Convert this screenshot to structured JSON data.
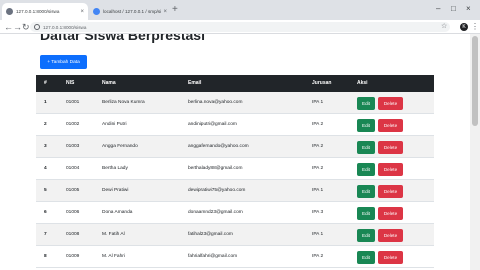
{
  "browser": {
    "tabs": [
      {
        "title": "127.0.0.1:8000/siswa",
        "close": "×"
      },
      {
        "title": "localhost / 127.0.0.1 / smp/siswa",
        "close": "×"
      }
    ],
    "new_tab": "+",
    "window_controls": {
      "minimize": "–",
      "maximize": "□",
      "close": "×"
    },
    "nav": {
      "back": "←",
      "forward": "→",
      "reload": "↻"
    },
    "url": "127.0.0.1:8000/siswa",
    "profile_initial": "K"
  },
  "page": {
    "title": "Daftar Siswa Berprestasi",
    "add_button": "+ Tambah Data"
  },
  "table": {
    "headers": {
      "no": "#",
      "nis": "NIS",
      "nama": "Nama",
      "email": "Email",
      "jurusan": "Jurusan",
      "aksi": "Aksi"
    },
    "edit_label": "Edit",
    "delete_label": "Delete",
    "rows": [
      {
        "no": "1",
        "nis": "01001",
        "nama": "Berliza Nova Kumra",
        "email": "berlina.nova@yahoo.com",
        "jurusan": "IPA 1"
      },
      {
        "no": "2",
        "nis": "01002",
        "nama": "Andini Putri",
        "email": "andiniputri@gmail.com",
        "jurusan": "IPA 2"
      },
      {
        "no": "3",
        "nis": "01003",
        "nama": "Angga Fernando",
        "email": "anggafernando@yahoo.com",
        "jurusan": "IPA 2"
      },
      {
        "no": "4",
        "nis": "01004",
        "nama": "Bertha Lady",
        "email": "berthalady88@gmail.com",
        "jurusan": "IPA 2"
      },
      {
        "no": "5",
        "nis": "01005",
        "nama": "Dewi Pratiwi",
        "email": "dewipratiwi75@yahoo.com",
        "jurusan": "IPA 1"
      },
      {
        "no": "6",
        "nis": "01006",
        "nama": "Dona Amanda",
        "email": "donaamnd23@gmail.com",
        "jurusan": "IPA 3"
      },
      {
        "no": "7",
        "nis": "01008",
        "nama": "M. Fatih Al",
        "email": "fatihal23@gmail.com",
        "jurusan": "IPA 1"
      },
      {
        "no": "8",
        "nis": "01009",
        "nama": "M. Al Fahri",
        "email": "fahrialfahri@gmail.com",
        "jurusan": "IPA 2"
      }
    ]
  },
  "colors": {
    "primary": "#0d6efd",
    "success": "#198754",
    "danger": "#dc3545",
    "table_header": "#212529"
  }
}
